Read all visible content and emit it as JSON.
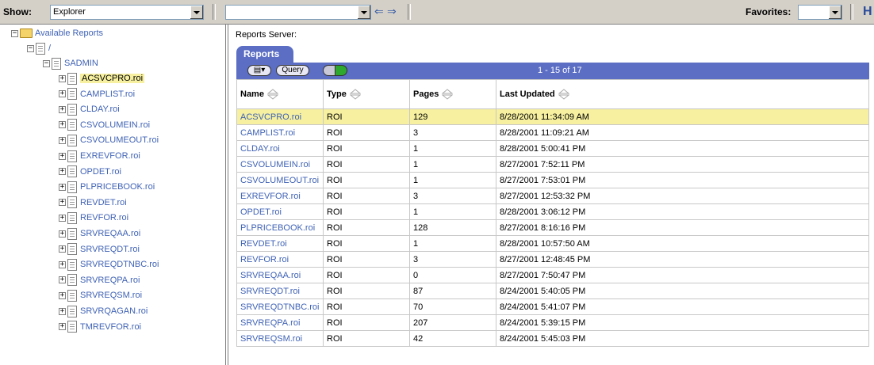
{
  "toolbar": {
    "show_label": "Show:",
    "show_value": "Explorer",
    "path_value": "",
    "favorites_label": "Favorites:",
    "favorites_value": ""
  },
  "tree": {
    "root": "Available Reports",
    "slash": "/",
    "folder": "SADMIN",
    "items": [
      "ACSVCPRO.roi",
      "CAMPLIST.roi",
      "CLDAY.roi",
      "CSVOLUMEIN.roi",
      "CSVOLUMEOUT.roi",
      "EXREVFOR.roi",
      "OPDET.roi",
      "PLPRICEBOOK.roi",
      "REVDET.roi",
      "REVFOR.roi",
      "SRVREQAA.roi",
      "SRVREQDT.roi",
      "SRVREQDTNBC.roi",
      "SRVREQPA.roi",
      "SRVREQSM.roi",
      "SRVRQAGAN.roi",
      "TMREVFOR.roi"
    ],
    "selected_index": 0
  },
  "main": {
    "server_label": "Reports Server:",
    "tab_label": "Reports",
    "query_label": "Query",
    "range_text": "1 - 15 of 17",
    "columns": [
      "Name",
      "Type",
      "Pages",
      "Last Updated"
    ],
    "rows": [
      [
        "ACSVCPRO.roi",
        "ROI",
        "129",
        "8/28/2001 11:34:09 AM"
      ],
      [
        "CAMPLIST.roi",
        "ROI",
        "3",
        "8/28/2001 11:09:21 AM"
      ],
      [
        "CLDAY.roi",
        "ROI",
        "1",
        "8/28/2001 5:00:41 PM"
      ],
      [
        "CSVOLUMEIN.roi",
        "ROI",
        "1",
        "8/27/2001 7:52:11 PM"
      ],
      [
        "CSVOLUMEOUT.roi",
        "ROI",
        "1",
        "8/27/2001 7:53:01 PM"
      ],
      [
        "EXREVFOR.roi",
        "ROI",
        "3",
        "8/27/2001 12:53:32 PM"
      ],
      [
        "OPDET.roi",
        "ROI",
        "1",
        "8/28/2001 3:06:12 PM"
      ],
      [
        "PLPRICEBOOK.roi",
        "ROI",
        "128",
        "8/27/2001 8:16:16 PM"
      ],
      [
        "REVDET.roi",
        "ROI",
        "1",
        "8/28/2001 10:57:50 AM"
      ],
      [
        "REVFOR.roi",
        "ROI",
        "3",
        "8/27/2001 12:48:45 PM"
      ],
      [
        "SRVREQAA.roi",
        "ROI",
        "0",
        "8/27/2001 7:50:47 PM"
      ],
      [
        "SRVREQDT.roi",
        "ROI",
        "87",
        "8/24/2001 5:40:05 PM"
      ],
      [
        "SRVREQDTNBC.roi",
        "ROI",
        "70",
        "8/24/2001 5:41:07 PM"
      ],
      [
        "SRVREQPA.roi",
        "ROI",
        "207",
        "8/24/2001 5:39:15 PM"
      ],
      [
        "SRVREQSM.roi",
        "ROI",
        "42",
        "8/24/2001 5:45:03 PM"
      ]
    ],
    "highlight_row": 0
  },
  "colors": {
    "accent": "#5b6ec4",
    "link": "#3f62b5",
    "highlight": "#f6f0a0",
    "chrome": "#d4d0c8"
  }
}
